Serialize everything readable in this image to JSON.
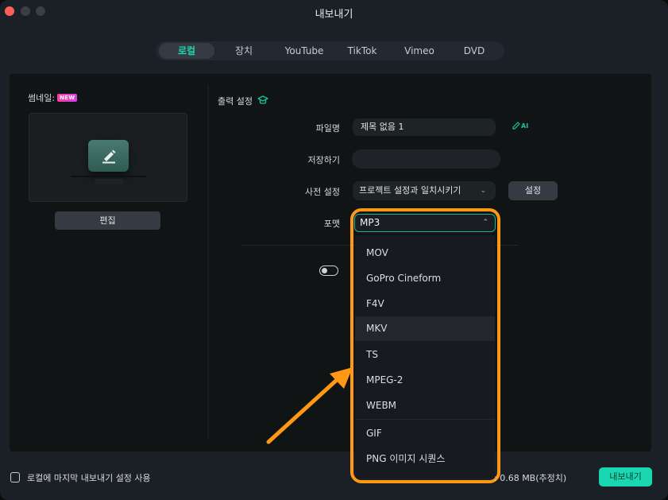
{
  "window": {
    "title": "내보내기"
  },
  "tabs": [
    {
      "label": "로컬",
      "active": true
    },
    {
      "label": "장치",
      "active": false
    },
    {
      "label": "YouTube",
      "active": false
    },
    {
      "label": "TikTok",
      "active": false
    },
    {
      "label": "Vimeo",
      "active": false
    },
    {
      "label": "DVD",
      "active": false
    }
  ],
  "thumbnail": {
    "label": "썸네일:",
    "badge": "NEW",
    "edit_button": "편집"
  },
  "output": {
    "title": "출력 설정",
    "filename_label": "파일명",
    "filename_value": "제목 없음 1",
    "ai_label": "AI",
    "save_label": "저장하기",
    "save_value": "",
    "preset_label": "사전 설정",
    "preset_value": "프로젝트 설정과 일치시키기",
    "preset_settings_button": "설정",
    "format_label": "포맷",
    "format_value": "MP3",
    "toggle_on": false
  },
  "format_dropdown": {
    "items": [
      {
        "label": "MOV"
      },
      {
        "label": "GoPro Cineform"
      },
      {
        "label": "F4V"
      },
      {
        "label": "MKV",
        "hovered": true
      },
      {
        "label": "TS"
      },
      {
        "label": "MPEG-2"
      },
      {
        "label": "WEBM"
      },
      {
        "label": "GIF"
      },
      {
        "label": "PNG 이미지 시퀀스"
      }
    ]
  },
  "footer": {
    "checkbox_label": "로컬에 마지막 내보내기 설정 사용",
    "checkbox_checked": false,
    "size_text": ": 0.68 MB(추정치)",
    "export_button": "내보내기"
  },
  "colors": {
    "accent": "#19d7b0",
    "highlight": "#ff9812",
    "close": "#fe5f57",
    "badge": "#ff3fa0"
  }
}
